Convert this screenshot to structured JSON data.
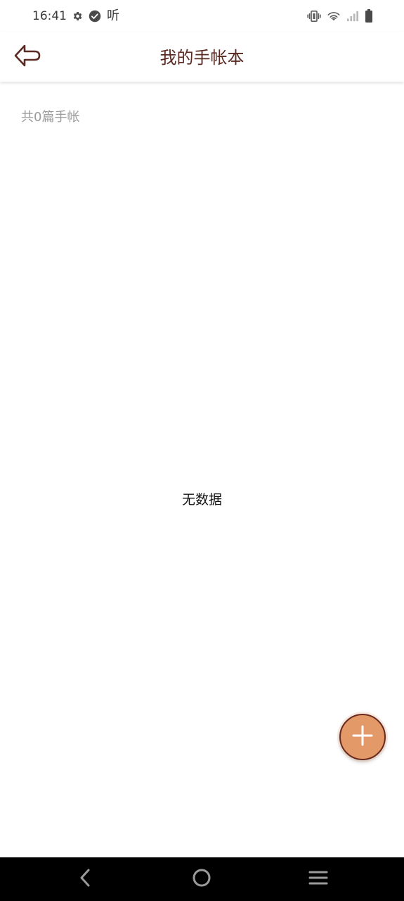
{
  "status_bar": {
    "time": "16:41",
    "app_indicator_text": "听",
    "left_icons": [
      "settings-icon",
      "check-circle-icon"
    ],
    "right_icons": [
      "vibrate-icon",
      "wifi-icon",
      "signal-icon",
      "battery-icon"
    ]
  },
  "header": {
    "back_icon": "back-arrow-icon",
    "title": "我的手帐本",
    "accent_color": "#5a2a23"
  },
  "content": {
    "count_label": "共0篇手帐",
    "empty_text": "无数据"
  },
  "fab": {
    "icon": "plus-icon",
    "fill_color": "#e49a68",
    "border_color": "#6b2a1f"
  },
  "nav_bar": {
    "buttons": [
      "nav-back-icon",
      "nav-home-icon",
      "nav-recents-icon"
    ]
  }
}
